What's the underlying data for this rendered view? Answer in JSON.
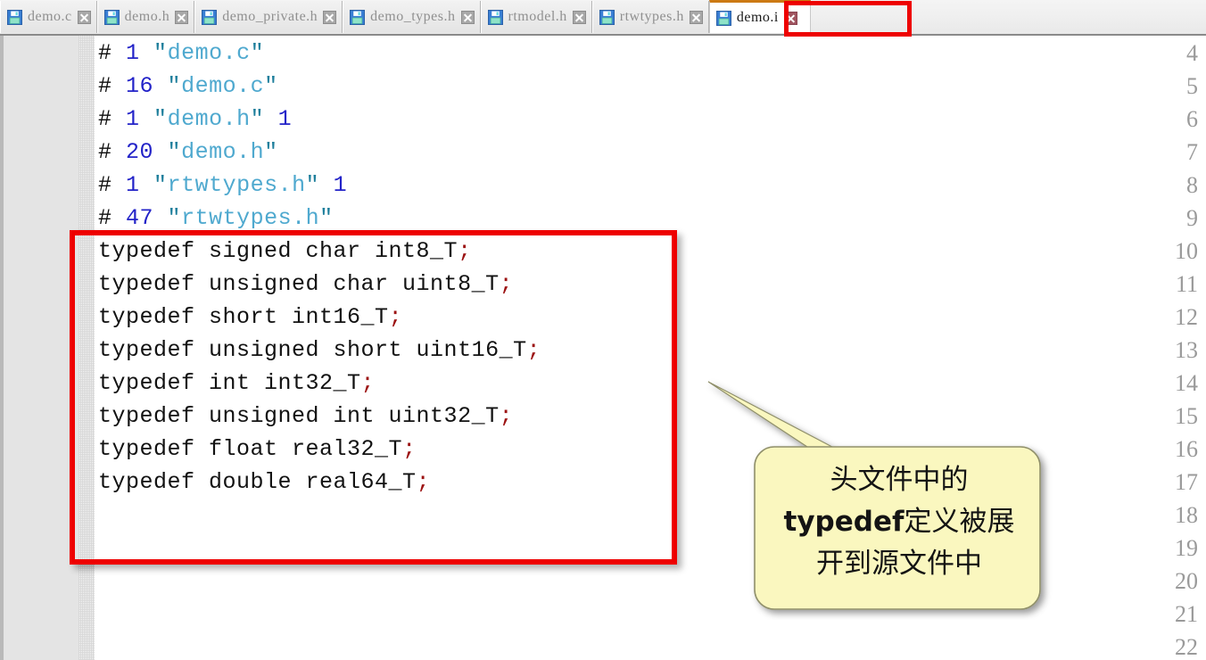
{
  "tabs": [
    {
      "label": "demo.c",
      "icon": "floppy-disk-icon",
      "close_icon": "close-icon",
      "active": false
    },
    {
      "label": "demo.h",
      "icon": "floppy-disk-icon",
      "close_icon": "close-icon",
      "active": false
    },
    {
      "label": "demo_private.h",
      "icon": "floppy-disk-icon",
      "close_icon": "close-icon",
      "active": false
    },
    {
      "label": "demo_types.h",
      "icon": "floppy-disk-icon",
      "close_icon": "close-icon",
      "active": false
    },
    {
      "label": "rtmodel.h",
      "icon": "floppy-disk-icon",
      "close_icon": "close-icon",
      "active": false
    },
    {
      "label": "rtwtypes.h",
      "icon": "floppy-disk-icon",
      "close_icon": "close-icon",
      "active": false
    },
    {
      "label": "demo.i",
      "icon": "floppy-disk-icon",
      "close_icon": "close-icon",
      "active": true
    }
  ],
  "editor": {
    "first_line_number": 4,
    "line_numbers": [
      4,
      5,
      6,
      7,
      8,
      9,
      10,
      11,
      12,
      13,
      14,
      15,
      16,
      17,
      18,
      19,
      20,
      21,
      22
    ],
    "lines": [
      {
        "n": 4,
        "tokens": [
          {
            "t": "# ",
            "c": "hash"
          },
          {
            "t": "1",
            "c": "num"
          },
          {
            "t": " ",
            "c": "plain"
          },
          {
            "t": "\"",
            "c": "quote"
          },
          {
            "t": "demo.c",
            "c": "str"
          },
          {
            "t": "\"",
            "c": "quote"
          }
        ]
      },
      {
        "n": 5,
        "tokens": [
          {
            "t": "# ",
            "c": "hash"
          },
          {
            "t": "16",
            "c": "num"
          },
          {
            "t": " ",
            "c": "plain"
          },
          {
            "t": "\"",
            "c": "quote"
          },
          {
            "t": "demo.c",
            "c": "str"
          },
          {
            "t": "\"",
            "c": "quote"
          }
        ]
      },
      {
        "n": 6,
        "tokens": [
          {
            "t": "# ",
            "c": "hash"
          },
          {
            "t": "1",
            "c": "num"
          },
          {
            "t": " ",
            "c": "plain"
          },
          {
            "t": "\"",
            "c": "quote"
          },
          {
            "t": "demo.h",
            "c": "str"
          },
          {
            "t": "\"",
            "c": "quote"
          },
          {
            "t": " ",
            "c": "plain"
          },
          {
            "t": "1",
            "c": "num"
          }
        ]
      },
      {
        "n": 7,
        "tokens": [
          {
            "t": "# ",
            "c": "hash"
          },
          {
            "t": "20",
            "c": "num"
          },
          {
            "t": " ",
            "c": "plain"
          },
          {
            "t": "\"",
            "c": "quote"
          },
          {
            "t": "demo.h",
            "c": "str"
          },
          {
            "t": "\"",
            "c": "quote"
          }
        ]
      },
      {
        "n": 8,
        "tokens": [
          {
            "t": "# ",
            "c": "hash"
          },
          {
            "t": "1",
            "c": "num"
          },
          {
            "t": " ",
            "c": "plain"
          },
          {
            "t": "\"",
            "c": "quote"
          },
          {
            "t": "rtwtypes.h",
            "c": "str"
          },
          {
            "t": "\"",
            "c": "quote"
          },
          {
            "t": " ",
            "c": "plain"
          },
          {
            "t": "1",
            "c": "num"
          }
        ]
      },
      {
        "n": 9,
        "tokens": [
          {
            "t": "# ",
            "c": "hash"
          },
          {
            "t": "47",
            "c": "num"
          },
          {
            "t": " ",
            "c": "plain"
          },
          {
            "t": "\"",
            "c": "quote"
          },
          {
            "t": "rtwtypes.h",
            "c": "str"
          },
          {
            "t": "\"",
            "c": "quote"
          }
        ]
      },
      {
        "n": 10,
        "tokens": [
          {
            "t": "typedef signed char int8_T",
            "c": "plain"
          },
          {
            "t": ";",
            "c": "semi"
          }
        ]
      },
      {
        "n": 11,
        "tokens": [
          {
            "t": "typedef unsigned char uint8_T",
            "c": "plain"
          },
          {
            "t": ";",
            "c": "semi"
          }
        ]
      },
      {
        "n": 12,
        "tokens": [
          {
            "t": "typedef short int16_T",
            "c": "plain"
          },
          {
            "t": ";",
            "c": "semi"
          }
        ]
      },
      {
        "n": 13,
        "tokens": [
          {
            "t": "typedef unsigned short uint16_T",
            "c": "plain"
          },
          {
            "t": ";",
            "c": "semi"
          }
        ]
      },
      {
        "n": 14,
        "tokens": [
          {
            "t": "typedef int int32_T",
            "c": "plain"
          },
          {
            "t": ";",
            "c": "semi"
          }
        ]
      },
      {
        "n": 15,
        "tokens": [
          {
            "t": "typedef unsigned int uint32_T",
            "c": "plain"
          },
          {
            "t": ";",
            "c": "semi"
          }
        ]
      },
      {
        "n": 16,
        "tokens": [
          {
            "t": "typedef float real32_T",
            "c": "plain"
          },
          {
            "t": ";",
            "c": "semi"
          }
        ]
      },
      {
        "n": 17,
        "tokens": [
          {
            "t": "typedef double real64_T",
            "c": "plain"
          },
          {
            "t": ";",
            "c": "semi"
          }
        ]
      },
      {
        "n": 18,
        "tokens": []
      },
      {
        "n": 19,
        "tokens": []
      },
      {
        "n": 20,
        "tokens": []
      },
      {
        "n": 21,
        "tokens": []
      },
      {
        "n": 22,
        "tokens": []
      }
    ]
  },
  "annotations": {
    "typedef_highlight": {
      "name": "typedef-block-highlight",
      "color": "#ee0000"
    },
    "active_tab_highlight": {
      "name": "active-tab-highlight",
      "color": "#ee0000"
    },
    "callout": {
      "fill": "#faf7bf",
      "stroke": "#8f8f6a",
      "line1": "头文件中的",
      "line2_bold": "typedef",
      "line2_rest": "定义被展",
      "line3": "开到源文件中"
    }
  },
  "colors": {
    "active_tab_top_border": "#cc7a14",
    "syntax_number": "#2323c8",
    "syntax_string": "#4fa9cf",
    "syntax_quote": "#1f7f9c",
    "syntax_semicolon": "#9c1313",
    "gutter_background": "#e4e4e4",
    "tabbar_background": "#eeeeee"
  }
}
